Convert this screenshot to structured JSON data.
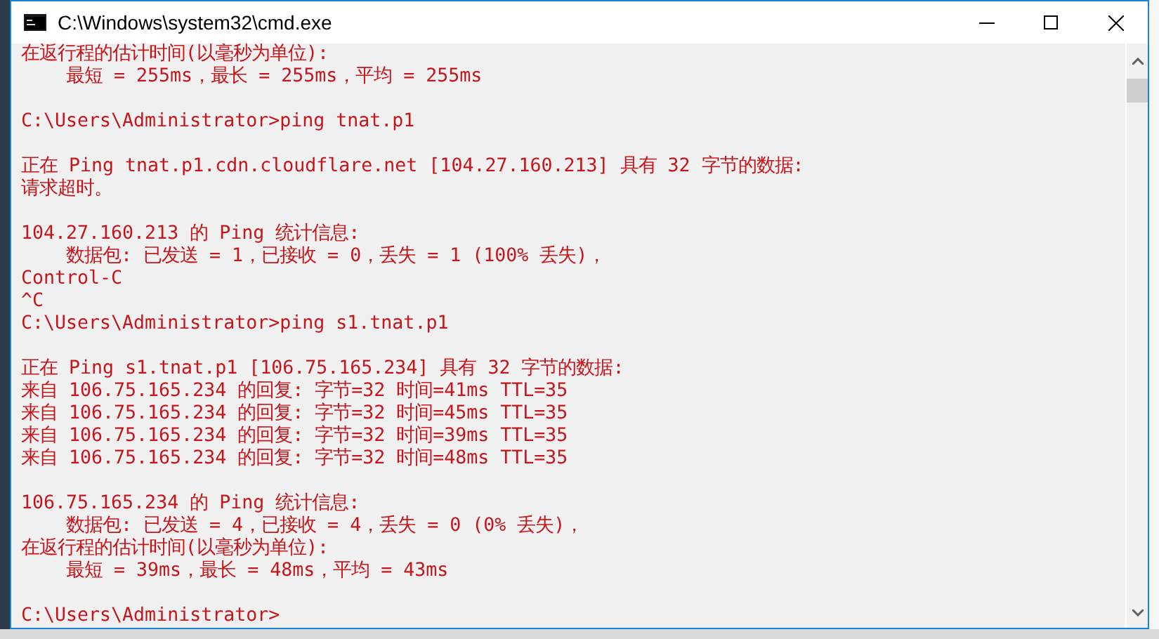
{
  "window": {
    "title": "C:\\Windows\\system32\\cmd.exe"
  },
  "console": {
    "lines": [
      {
        "kind": "text",
        "text": "在返行程的估计时间(以毫秒为单位):"
      },
      {
        "kind": "text",
        "text": "    最短 = 255ms，最长 = 255ms，平均 = 255ms"
      },
      {
        "kind": "blank"
      },
      {
        "kind": "text",
        "text": "C:\\Users\\Administrator>ping tnat.p1"
      },
      {
        "kind": "blank"
      },
      {
        "kind": "text",
        "text": "正在 Ping tnat.p1.cdn.cloudflare.net [104.27.160.213] 具有 32 字节的数据:"
      },
      {
        "kind": "text",
        "text": "请求超时。"
      },
      {
        "kind": "blank"
      },
      {
        "kind": "text",
        "text": "104.27.160.213 的 Ping 统计信息:"
      },
      {
        "kind": "text",
        "text": "    数据包: 已发送 = 1，已接收 = 0，丢失 = 1 (100% 丢失)，"
      },
      {
        "kind": "text",
        "text": "Control-C"
      },
      {
        "kind": "text",
        "text": "^C"
      },
      {
        "kind": "text",
        "text": "C:\\Users\\Administrator>ping s1.tnat.p1"
      },
      {
        "kind": "blank"
      },
      {
        "kind": "text",
        "text": "正在 Ping s1.tnat.p1 [106.75.165.234] 具有 32 字节的数据:"
      },
      {
        "kind": "text",
        "text": "来自 106.75.165.234 的回复: 字节=32 时间=41ms TTL=35"
      },
      {
        "kind": "text",
        "text": "来自 106.75.165.234 的回复: 字节=32 时间=45ms TTL=35"
      },
      {
        "kind": "text",
        "text": "来自 106.75.165.234 的回复: 字节=32 时间=39ms TTL=35"
      },
      {
        "kind": "text",
        "text": "来自 106.75.165.234 的回复: 字节=32 时间=48ms TTL=35"
      },
      {
        "kind": "blank"
      },
      {
        "kind": "text",
        "text": "106.75.165.234 的 Ping 统计信息:"
      },
      {
        "kind": "text",
        "text": "    数据包: 已发送 = 4，已接收 = 4，丢失 = 0 (0% 丢失)，"
      },
      {
        "kind": "text",
        "text": "在返行程的估计时间(以毫秒为单位):"
      },
      {
        "kind": "text",
        "text": "    最短 = 39ms，最长 = 48ms，平均 = 43ms"
      },
      {
        "kind": "blank"
      },
      {
        "kind": "text",
        "text": "C:\\Users\\Administrator>"
      }
    ]
  }
}
